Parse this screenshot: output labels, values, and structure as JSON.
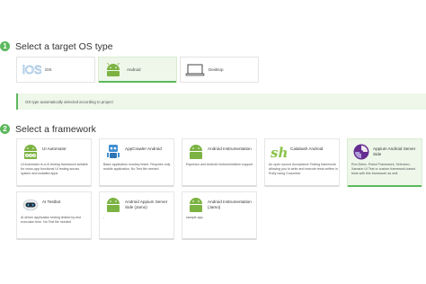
{
  "steps": [
    {
      "number": "1",
      "title": "Select a target OS type"
    },
    {
      "number": "2",
      "title": "Select a framework"
    }
  ],
  "os_types": [
    {
      "label": "iOS",
      "icon": "ios-logo-icon",
      "selected": false
    },
    {
      "label": "Android",
      "icon": "android-robot-icon",
      "selected": true
    },
    {
      "label": "Desktop",
      "icon": "laptop-icon",
      "selected": false
    }
  ],
  "info": {
    "text": "OS type automatically selected according to project"
  },
  "frameworks": [
    {
      "name": "UI Automator",
      "description": "UI Automator is a UI testing framework suitable for cross-app functional UI testing across system and installed apps",
      "icon": "android-check-icon",
      "selected": false
    },
    {
      "name": "AppCrawler Android",
      "description": "Basic application monkey tester. Requires only mobile application. No Test file needed",
      "icon": "robot-icon",
      "selected": false
    },
    {
      "name": "Android Instrumentation",
      "description": "Espresso and Android Instrumentation support",
      "icon": "android-robot-icon",
      "selected": false
    },
    {
      "name": "Calabash Android",
      "description": "An open source Acceptance Testing framework allowing you to write and execute tests written in Ruby using Cucumber",
      "icon": "calabash-icon",
      "selected": false
    },
    {
      "name": "Appium Android Server Side",
      "description": "Run Detox, Robot Framework, Selenium, Xamarin UI Test or custom framework-based tests with this framework as well",
      "icon": "appium-icon",
      "selected": true
    },
    {
      "name": "AI Testbot",
      "description": "AI driven application testing limited by test execution time. No Test file needed",
      "icon": "ai-bot-icon",
      "selected": false
    },
    {
      "name": "Android Appium Server Side (Jamo)",
      "description": "-",
      "icon": "android-robot-icon",
      "selected": false
    },
    {
      "name": "Android Instrumentation (Jamo)",
      "description": "sample app",
      "icon": "android-robot-icon",
      "selected": false
    }
  ],
  "colors": {
    "accent": "#5cb85c",
    "selected_bg": "#eef7ea",
    "android_green": "#7cb342",
    "appium_purple": "#662d91"
  }
}
